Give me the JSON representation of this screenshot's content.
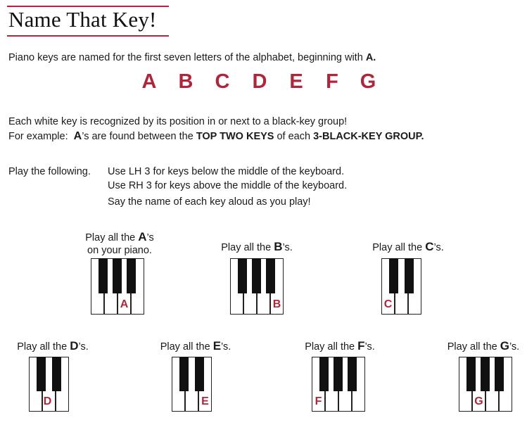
{
  "title": "Name That Key!",
  "intro": {
    "text": "Piano keys are named for the first seven letters of the alphabet, beginning with ",
    "bold": "A."
  },
  "letters": [
    "A",
    "B",
    "C",
    "D",
    "E",
    "F",
    "G"
  ],
  "recognize": {
    "line1": "Each white key is recognized by its position in or next to a black-key group!",
    "line2_prefix": "For example:  ",
    "line2_bold_a": "A",
    "line2_mid": "’s are found between the ",
    "line2_bold_top": "TOP TWO KEYS",
    "line2_of": " of each ",
    "line2_bold_group": "3-BLACK-KEY GROUP."
  },
  "play": {
    "lead": "Play the following.",
    "line1": "Use LH 3 for keys below the middle of the keyboard.",
    "line2": "Use RH 3 for keys above the middle of the keyboard.",
    "line3": "Say the name of each key aloud as you play!"
  },
  "exercises": {
    "a": {
      "pre": "Play all the ",
      "key": "A",
      "post": "’s",
      "line2": "on your piano.",
      "label": "A"
    },
    "b": {
      "pre": "Play all the ",
      "key": "B",
      "post": "’s.",
      "label": "B"
    },
    "c": {
      "pre": "Play all the ",
      "key": "C",
      "post": "’s.",
      "label": "C"
    },
    "d": {
      "pre": "Play all the ",
      "key": "D",
      "post": "’s.",
      "label": "D"
    },
    "e": {
      "pre": "Play all the ",
      "key": "E",
      "post": "’s.",
      "label": "E"
    },
    "f": {
      "pre": "Play all the ",
      "key": "F",
      "post": "’s.",
      "label": "F"
    },
    "g": {
      "pre": "Play all the ",
      "key": "G",
      "post": "’s.",
      "label": "G"
    }
  },
  "colors": {
    "accent": "#b0253a",
    "black_key": "#111111"
  }
}
